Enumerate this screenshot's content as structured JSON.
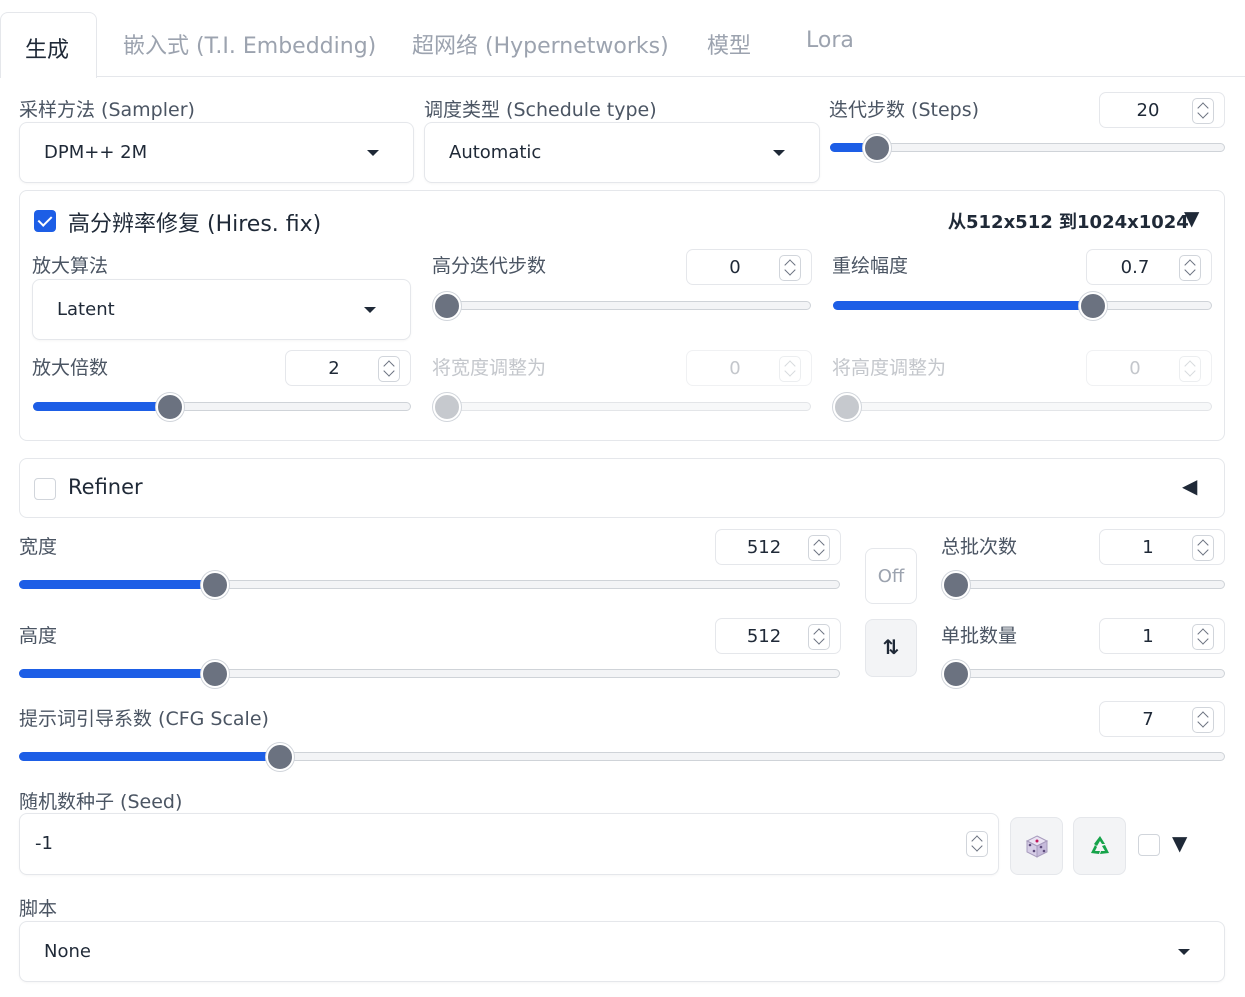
{
  "tabs": [
    "生成",
    "嵌入式 (T.I. Embedding)",
    "超网络 (Hypernetworks)",
    "模型",
    "Lora"
  ],
  "sampler": {
    "label": "采样方法 (Sampler)",
    "value": "DPM++ 2M"
  },
  "schedule": {
    "label": "调度类型 (Schedule type)",
    "value": "Automatic"
  },
  "steps": {
    "label": "迭代步数 (Steps)",
    "value": "20",
    "level": 0.09
  },
  "hires": {
    "label": "高分辨率修复 (Hires. fix)",
    "checked": true,
    "summary": "从512x512 到1024x1024",
    "summary_toggle": "▼",
    "upscaler": {
      "label": "放大算法",
      "value": "Latent"
    },
    "hires_steps": {
      "label": "高分迭代步数",
      "value": "0",
      "level": 0.0
    },
    "denoise": {
      "label": "重绘幅度",
      "value": "0.7",
      "level": 0.7
    },
    "upscale_by": {
      "label": "放大倍数",
      "value": "2",
      "level": 0.35
    },
    "resize_width": {
      "label": "将宽度调整为",
      "value": "0",
      "level": 0.0
    },
    "resize_height": {
      "label": "将高度调整为",
      "value": "0",
      "level": 0.0
    }
  },
  "refiner": {
    "label": "Refiner",
    "checked": false,
    "toggle": "◀"
  },
  "width": {
    "label": "宽度",
    "value": "512",
    "level": 0.23
  },
  "height": {
    "label": "高度",
    "value": "512",
    "level": 0.23
  },
  "off_button": "Off",
  "swap_button": "⇅",
  "batch_count": {
    "label": "总批次数",
    "value": "1",
    "level": 0.0
  },
  "batch_size": {
    "label": "单批数量",
    "value": "1",
    "level": 0.0
  },
  "cfg": {
    "label": "提示词引导系数 (CFG Scale)",
    "value": "7",
    "level": 0.21
  },
  "seed": {
    "label": "随机数种子 (Seed)",
    "value": "-1",
    "extra_toggle": "▼"
  },
  "script": {
    "label": "脚本",
    "value": "None"
  },
  "colors": {
    "accent": "#1d5ee6",
    "thumb": "#6b7280",
    "recycle": "#16a34a"
  },
  "icons": [
    "dice-icon",
    "recycle-icon"
  ]
}
